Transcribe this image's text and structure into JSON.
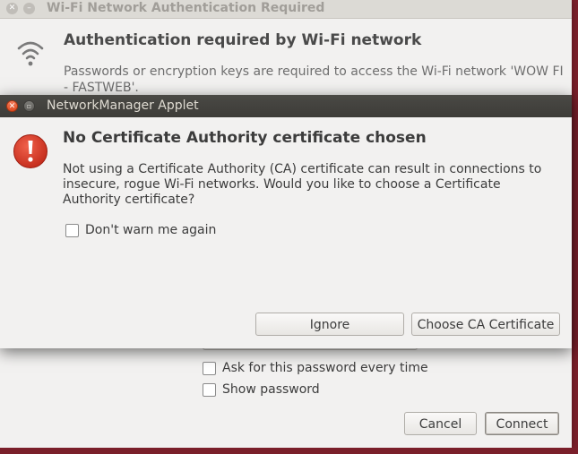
{
  "bg_window": {
    "title": "Wi-Fi Network Authentication Required",
    "icon": "wifi-icon",
    "heading": "Authentication required by Wi-Fi network",
    "description": "Passwords or encryption keys are required to access the Wi-Fi network 'WOW FI - FASTWEB'.",
    "ask_password_label": "Ask for this password every time",
    "ask_password_checked": false,
    "show_password_label": "Show password",
    "show_password_checked": false,
    "cancel_label": "Cancel",
    "connect_label": "Connect"
  },
  "dialog": {
    "title": "NetworkManager Applet",
    "icon": "warning-icon",
    "heading": "No Certificate Authority certificate chosen",
    "description": "Not using a Certificate Authority (CA) certificate can result in connections to insecure, rogue Wi-Fi networks.  Would you like to choose a Certificate Authority certificate?",
    "dont_warn_label": "Don't warn me again",
    "dont_warn_checked": false,
    "ignore_label": "Ignore",
    "choose_ca_label": "Choose CA Certificate"
  },
  "colors": {
    "accent_red": "#df4a1f",
    "desktop": "#7a1f2a",
    "dialog_titlebar": "#3d3c38"
  }
}
